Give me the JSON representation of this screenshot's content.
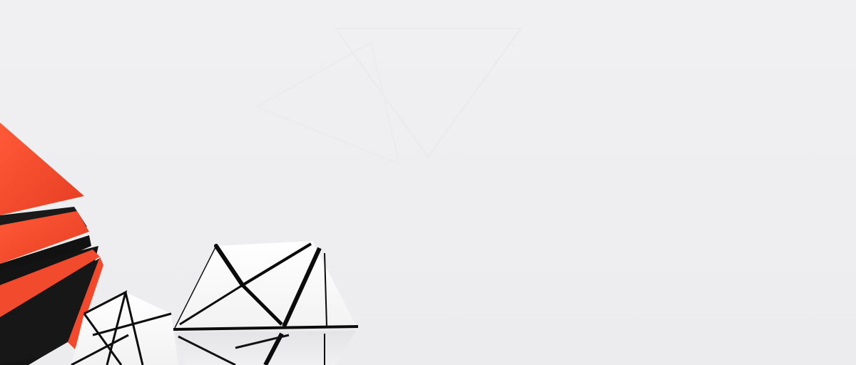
{
  "scene": {
    "background_color": "#efeff1",
    "accent_color": "#f2492c",
    "dark_color": "#161616",
    "white_color": "#fbfbfb",
    "objects": [
      {
        "name": "orange-striped-object",
        "colors": [
          "#f2492c",
          "#161616"
        ]
      },
      {
        "name": "white-geometric-shape-large",
        "colors": [
          "#fbfbfb",
          "#0d0d0d"
        ]
      },
      {
        "name": "white-geometric-shape-small",
        "colors": [
          "#fbfbfb",
          "#0d0d0d"
        ]
      }
    ]
  }
}
